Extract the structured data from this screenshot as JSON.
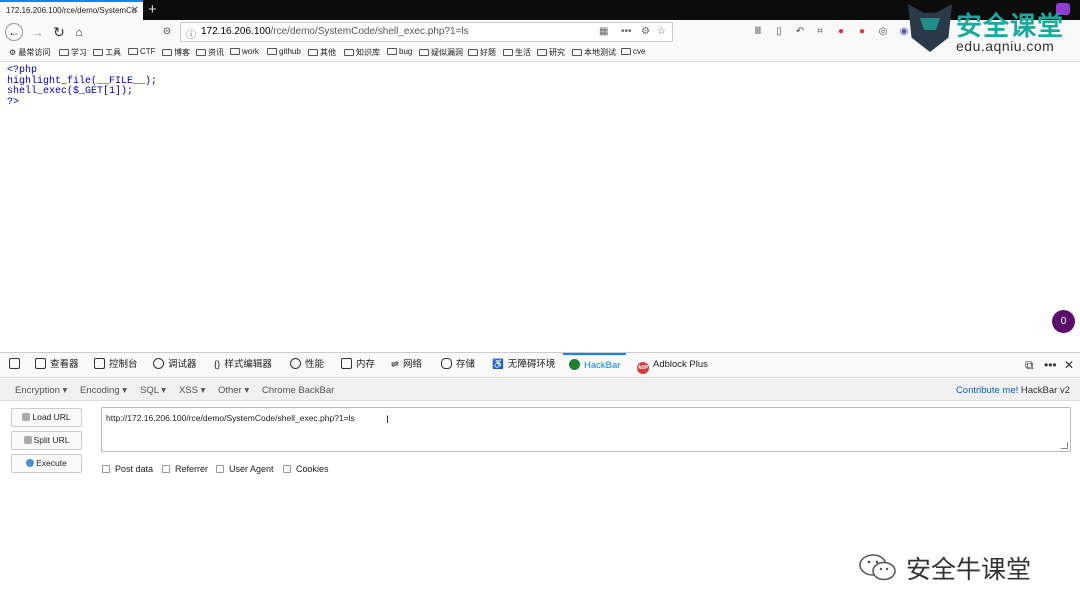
{
  "browser": {
    "tab_title": "172.16.206.100/rce/demo/SystemCo",
    "url_host": "172.16.206.100",
    "url_path": "/rce/demo/SystemCode/shell_exec.php?1=ls"
  },
  "bookmarks": [
    "最常访问",
    "学习",
    "工具",
    "CTF",
    "博客",
    "资讯",
    "work",
    "github",
    "其他",
    "知识库",
    "bug",
    "疑似漏洞",
    "好题",
    "生活",
    "研究",
    "本地测试",
    "cve"
  ],
  "code_lines": [
    {
      "text": "<?php",
      "color": "#0000bb"
    },
    {
      "text": "highlight_file(__FILE__);",
      "color": "#0000bb"
    },
    {
      "text": "shell_exec($_GET[1]);",
      "color": "#0000bb"
    },
    {
      "text": "?>",
      "color": "#0000bb"
    }
  ],
  "badge_count": "0",
  "logo": {
    "title": "安全课堂",
    "url": "edu.aqniu.com"
  },
  "devtools": {
    "tabs": [
      "查看器",
      "控制台",
      "调试器",
      "样式编辑器",
      "性能",
      "内存",
      "网络",
      "存储",
      "无障碍环境",
      "HackBar",
      "Adblock Plus"
    ],
    "active_tab": "HackBar"
  },
  "hackbar": {
    "menu": [
      "Encryption ▾",
      "Encoding ▾",
      "SQL ▾",
      "XSS ▾",
      "Other ▾",
      "Chrome BackBar"
    ],
    "contribute": "Contribute me!",
    "version": "HackBar v2",
    "buttons": [
      "Load URL",
      "Split URL",
      "Execute"
    ],
    "url_value": "http://172.16.206.100/rce/demo/SystemCode/shell_exec.php?1=ls",
    "checkboxes": [
      "Post data",
      "Referrer",
      "User Agent",
      "Cookies"
    ]
  },
  "watermark": "安全牛课堂",
  "colors": {
    "accent": "#0a84ff",
    "hackbar_green": "#1e7f2d",
    "badge": "#5b0d6a",
    "logo": "#1aa99e"
  }
}
